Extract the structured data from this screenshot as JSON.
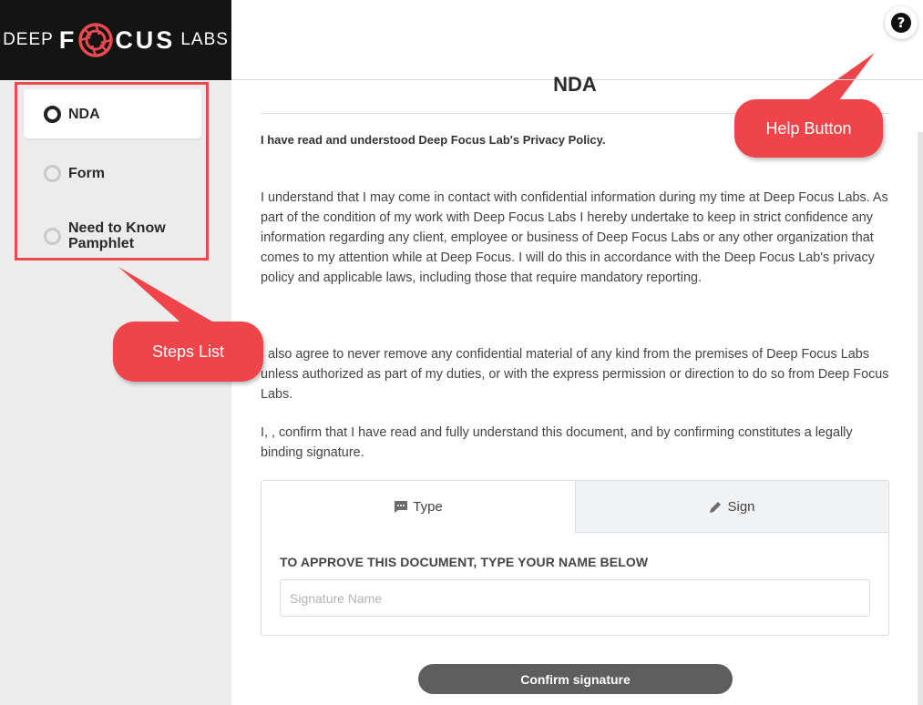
{
  "brand": {
    "word_left": "DEEP",
    "word_center_left": "F",
    "word_center_right": "CUS",
    "word_right": "LABS",
    "accent": "#e84a4f"
  },
  "steps": [
    {
      "label": "NDA",
      "state": "active"
    },
    {
      "label": "Form",
      "state": "pending"
    },
    {
      "label": "Need to Know Pamphlet",
      "state": "pending"
    }
  ],
  "callouts": {
    "steps": "Steps List",
    "help": "Help Button"
  },
  "help": {
    "icon": "question-icon",
    "glyph": "?"
  },
  "document": {
    "title": "NDA",
    "policy_line": "I have read and understood Deep Focus Lab's Privacy Policy.",
    "paragraph_1": "I understand that I may come in contact with confidential information during my time at Deep Focus Labs. As part of the condition of my work with Deep Focus Labs I hereby undertake to keep in strict confidence any information regarding any client, employee or business of Deep Focus Labs or any other organization that comes to my attention while at Deep Focus. I will do this in accordance with the Deep Focus Lab's privacy policy and applicable laws, including those that require mandatory reporting.",
    "paragraph_2": "I also agree to never remove any confidential material of any kind from the premises of Deep Focus Labs unless authorized as part of my duties, or with the express permission or direction to do so from Deep Focus Labs.",
    "paragraph_3": "I, , confirm that I have read and fully understand this document, and by confirming constitutes a legally binding signature."
  },
  "signature": {
    "tabs": [
      {
        "label": "Type",
        "icon": "chat-icon",
        "selected": true
      },
      {
        "label": "Sign",
        "icon": "pencil-icon",
        "selected": false
      }
    ],
    "instruction": "TO APPROVE THIS DOCUMENT, TYPE YOUR NAME BELOW",
    "input_value": "",
    "input_placeholder": "Signature Name",
    "confirm_label": "Confirm signature"
  }
}
